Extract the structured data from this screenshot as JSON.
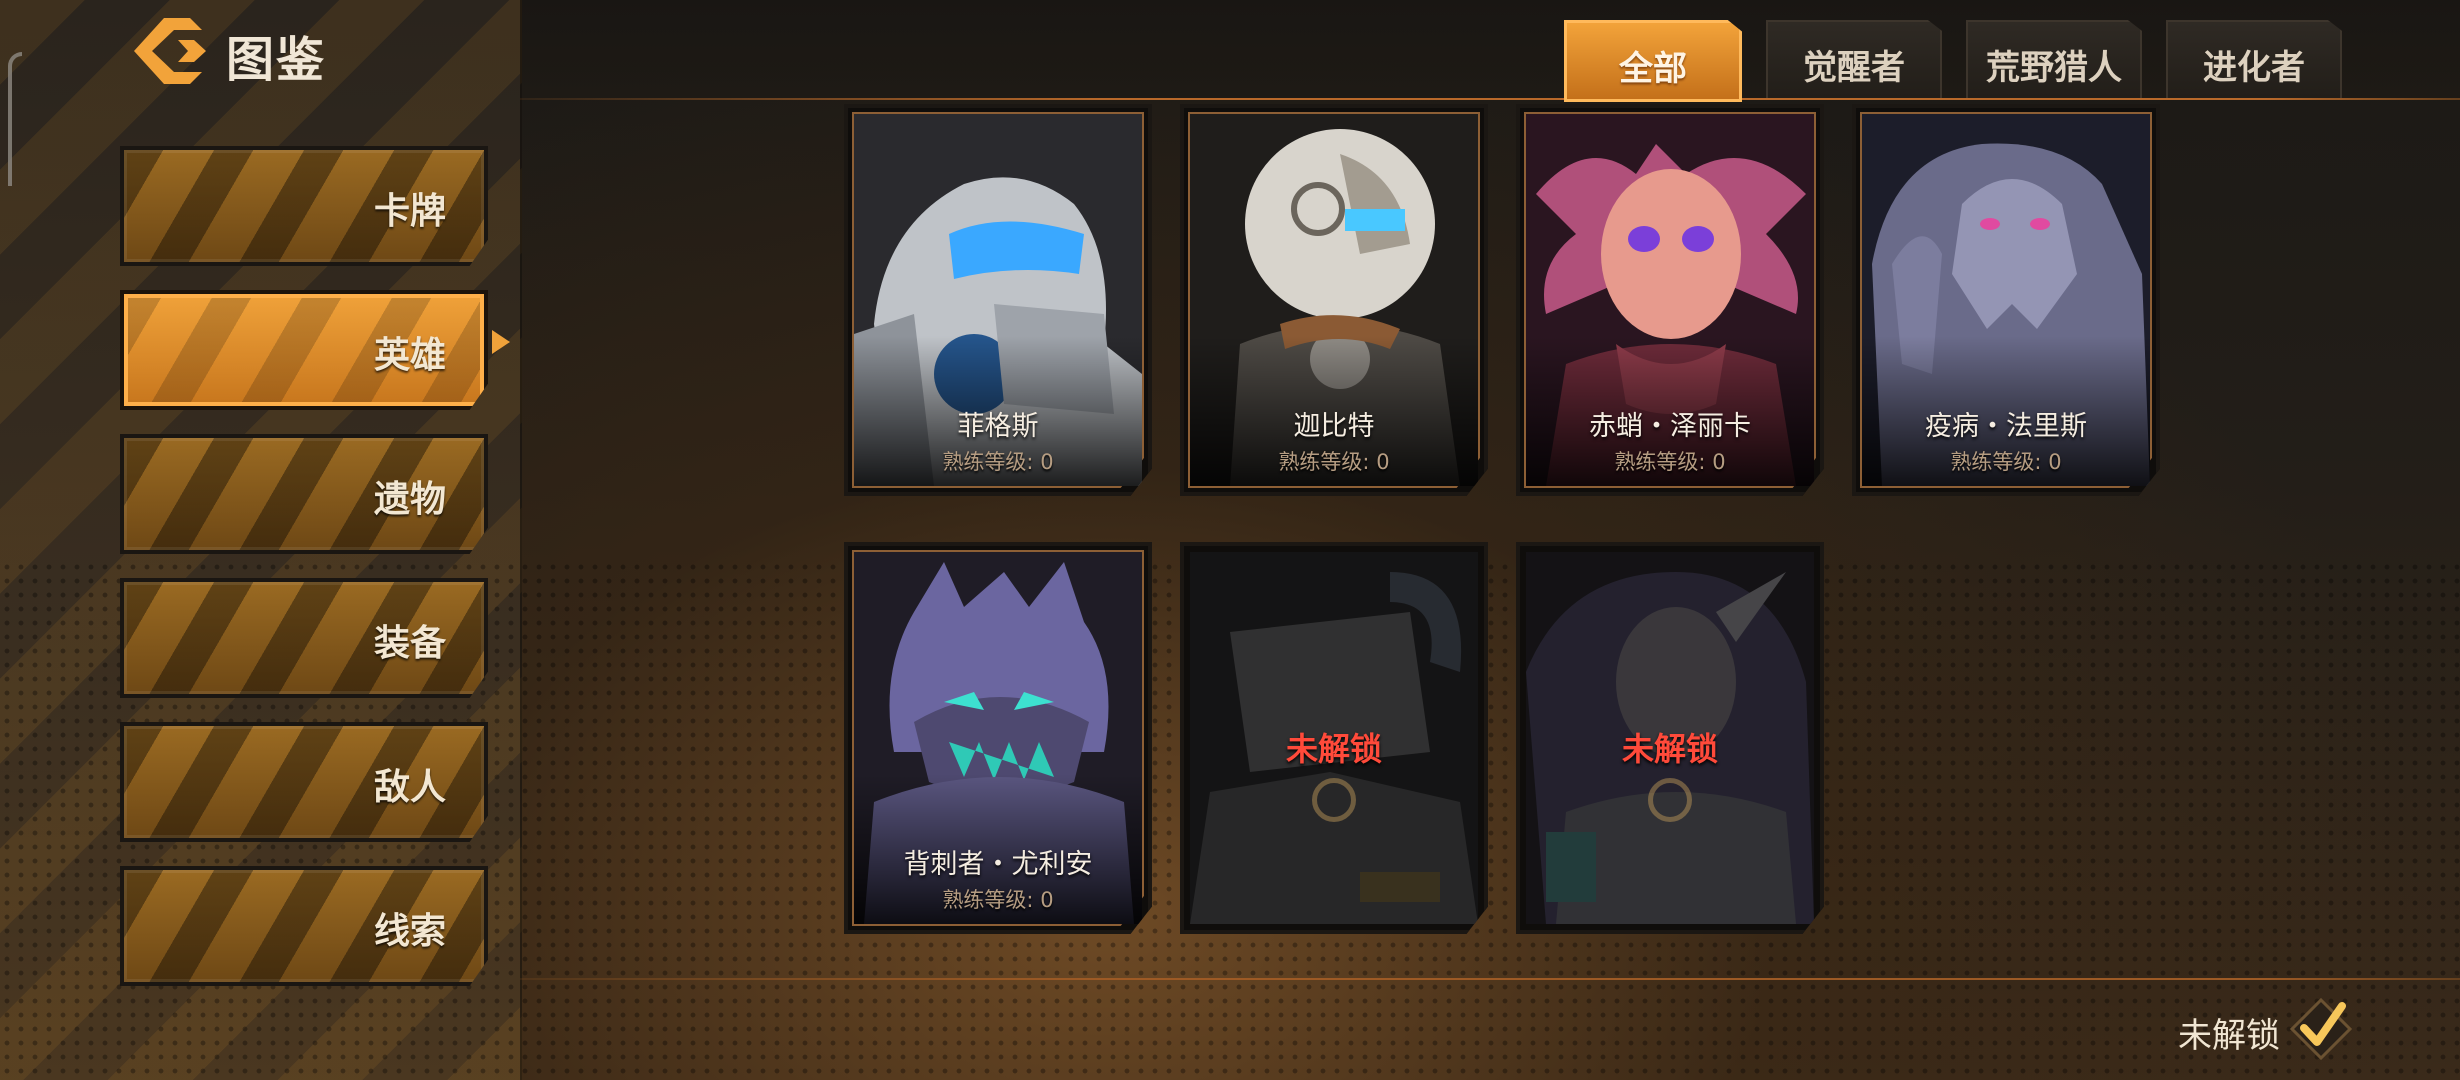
{
  "header": {
    "title": "图鉴"
  },
  "sidebar": {
    "items": [
      {
        "label": "卡牌",
        "active": false
      },
      {
        "label": "英雄",
        "active": true
      },
      {
        "label": "遗物",
        "active": false
      },
      {
        "label": "装备",
        "active": false
      },
      {
        "label": "敌人",
        "active": false
      },
      {
        "label": "线索",
        "active": false
      }
    ]
  },
  "tabs": [
    {
      "label": "全部",
      "active": true
    },
    {
      "label": "觉醒者",
      "active": false
    },
    {
      "label": "荒野猎人",
      "active": false
    },
    {
      "label": "进化者",
      "active": false
    }
  ],
  "heroes": [
    {
      "name": "菲格斯",
      "level": "熟练等级: 0",
      "locked": false
    },
    {
      "name": "迦比特",
      "level": "熟练等级: 0",
      "locked": false
    },
    {
      "name": "赤蛸・泽丽卡",
      "level": "熟练等级: 0",
      "locked": false
    },
    {
      "name": "疫病・法里斯",
      "level": "熟练等级: 0",
      "locked": false
    },
    {
      "name": "背刺者・尤利安",
      "level": "熟练等级: 0",
      "locked": false
    },
    {
      "lock_text": "未解锁",
      "locked": true
    },
    {
      "lock_text": "未解锁",
      "locked": true
    }
  ],
  "footer": {
    "filter_label": "未解锁",
    "filter_checked": true
  },
  "colors": {
    "accent": "#f0a23a",
    "locked_text": "#ff4a3a"
  }
}
